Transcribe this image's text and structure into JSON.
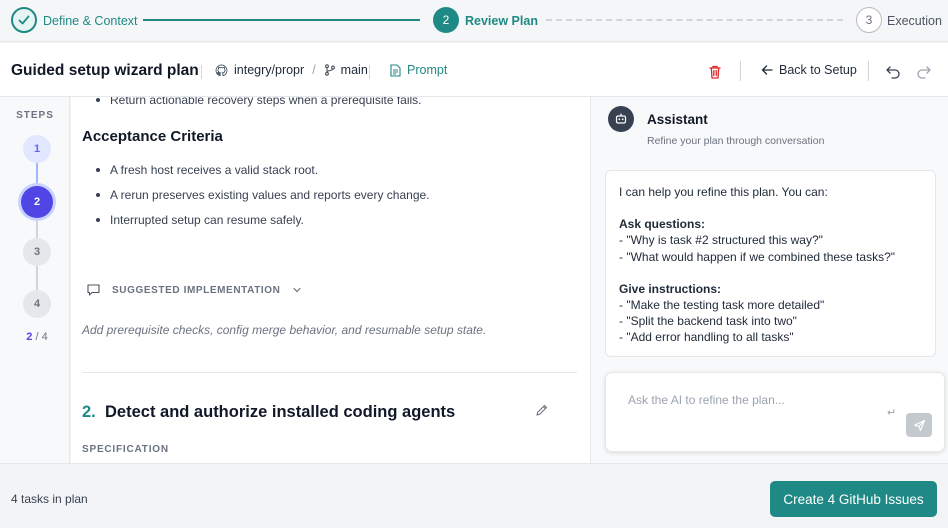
{
  "wizard": {
    "steps": [
      {
        "number": "1",
        "label": "Define & Context",
        "state": "done"
      },
      {
        "number": "2",
        "label": "Review Plan",
        "state": "active"
      },
      {
        "number": "3",
        "label": "Execution",
        "state": "pending"
      }
    ]
  },
  "header": {
    "title": "Guided setup wizard plan",
    "repo": "integry/propr",
    "separator": "/",
    "branch": "main",
    "prompt_label": "Prompt",
    "back_label": "Back to Setup"
  },
  "rail": {
    "title": "STEPS",
    "nodes": [
      "1",
      "2",
      "3",
      "4"
    ],
    "current": "2",
    "total_text": " / 4"
  },
  "content": {
    "partial_bullet": "Return actionable recovery steps when a prerequisite fails.",
    "acceptance_heading": "Acceptance Criteria",
    "acceptance_items": [
      "A fresh host receives a valid stack root.",
      "A rerun preserves existing values and reports every change.",
      "Interrupted setup can resume safely."
    ],
    "suggested_label": "SUGGESTED IMPLEMENTATION",
    "suggested_text": "Add prerequisite checks, config merge behavior, and resumable setup state.",
    "task_number": "2.",
    "task_title": "Detect and authorize installed coding agents",
    "spec_label": "SPECIFICATION"
  },
  "assistant": {
    "title": "Assistant",
    "subtitle": "Refine your plan through conversation",
    "message": {
      "intro": "I can help you refine this plan. You can:",
      "questions_heading": "Ask questions:",
      "questions": [
        "- \"Why is task #2 structured this way?\"",
        "- \"What would happen if we combined these tasks?\""
      ],
      "instructions_heading": "Give instructions:",
      "instructions": [
        "- \"Make the testing task more detailed\"",
        "- \"Split the backend task into two\"",
        "- \"Add error handling to all tasks\""
      ]
    },
    "input_placeholder": "Ask the AI to refine the plan...",
    "enter_hint": "↵"
  },
  "footer": {
    "task_count": "4 tasks in plan",
    "create_label": "Create 4 GitHub Issues"
  },
  "colors": {
    "teal": "#1f8a85",
    "indigo": "#4f46e5",
    "danger": "#dc2626"
  },
  "icons": {
    "done_step": "check-icon",
    "repo": "github-icon",
    "branch": "git-branch-icon",
    "prompt": "document-icon",
    "delete": "trash-icon",
    "back": "arrow-left-icon",
    "undo": "undo-icon",
    "redo": "redo-icon",
    "suggested": "comment-icon",
    "expand": "chevron-down-icon",
    "edit": "pencil-icon",
    "assistant": "robot-icon",
    "send": "send-icon"
  }
}
